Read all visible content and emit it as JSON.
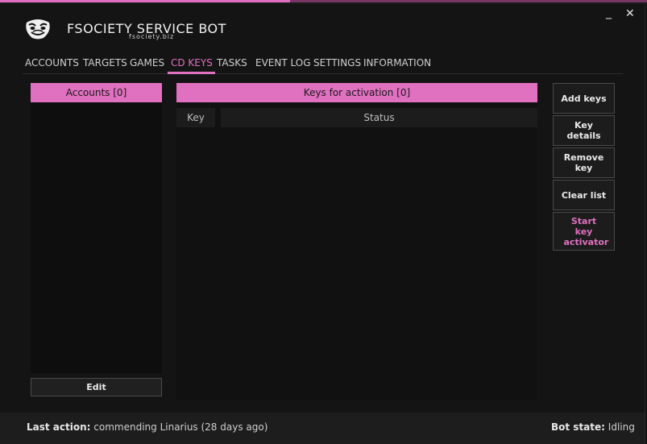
{
  "window": {
    "minimize_glyph": "_",
    "close_glyph": "✕"
  },
  "brand": {
    "title": "FSOCIETY SERVICE BOT",
    "subtitle": "fsociety.biz",
    "logo_icon": "fsociety-mask-icon"
  },
  "tabs": [
    {
      "label": "ACCOUNTS",
      "active": false
    },
    {
      "label": "TARGETS",
      "active": false
    },
    {
      "label": "GAMES",
      "active": false
    },
    {
      "label": "CD KEYS",
      "active": true
    },
    {
      "label": "TASKS",
      "active": false
    },
    {
      "label": "EVENT LOG",
      "active": false
    },
    {
      "label": "SETTINGS",
      "active": false
    },
    {
      "label": "INFORMATION",
      "active": false
    }
  ],
  "accounts_panel": {
    "header": "Accounts [0]",
    "edit_label": "Edit"
  },
  "keys_panel": {
    "header": "Keys for activation [0]",
    "columns": [
      "Key",
      "Status"
    ]
  },
  "actions": [
    {
      "label": "Add keys"
    },
    {
      "label": "Key details"
    },
    {
      "label": "Remove key"
    },
    {
      "label": "Clear list"
    },
    {
      "label": "Start key activator",
      "accent": true
    }
  ],
  "status": {
    "last_action_label": "Last action:",
    "last_action_value": "commending Linarius (28 days ago)",
    "bot_state_label": "Bot state:",
    "bot_state_value": "Idling"
  },
  "colors": {
    "accent": "#e070c0",
    "background": "#111111"
  }
}
